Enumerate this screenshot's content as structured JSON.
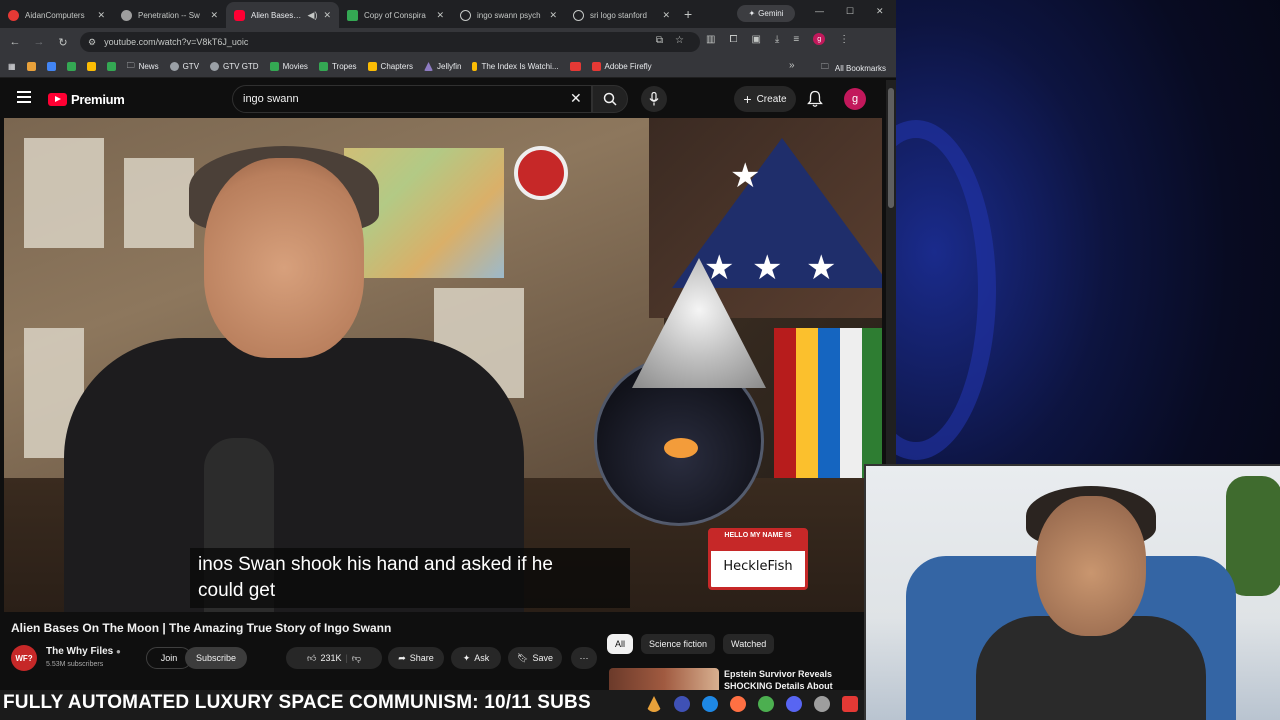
{
  "browser": {
    "tabs": [
      {
        "label": "AidanComputers",
        "color": "#e53935",
        "active": false
      },
      {
        "label": "Penetration -- Sw",
        "color": "#9e9e9e",
        "active": false
      },
      {
        "label": "Alien Bases O",
        "color": "#ff0033",
        "active": true
      },
      {
        "label": "Copy of Conspira",
        "color": "#34a853",
        "active": false
      },
      {
        "label": "ingo swann psych",
        "color": "#9e9e9e",
        "active": false
      },
      {
        "label": "sri logo stanford",
        "color": "#9e9e9e",
        "active": false
      }
    ],
    "gemini_label": "Gemini",
    "url": "youtube.com/watch?v=V8kT6J_uoic",
    "bookmarks": [
      {
        "label": "",
        "color": "#e8a13a"
      },
      {
        "label": "",
        "color": "#4285f4"
      },
      {
        "label": "",
        "color": "#34a853"
      },
      {
        "label": "",
        "color": "#fbbc04"
      },
      {
        "label": "",
        "color": "#34a853"
      },
      {
        "label": "News",
        "color": "#9aa0a6"
      },
      {
        "label": "GTV",
        "color": "#9aa0a6"
      },
      {
        "label": "GTV GTD",
        "color": "#9aa0a6"
      },
      {
        "label": "Movies",
        "color": "#34a853"
      },
      {
        "label": "Tropes",
        "color": "#34a853"
      },
      {
        "label": "Chapters",
        "color": "#fbbc04"
      },
      {
        "label": "Jellyfin",
        "color": "#8e7cc3"
      },
      {
        "label": "The Index Is Watchi...",
        "color": "#fbbc04"
      },
      {
        "label": "",
        "color": "#e53935"
      },
      {
        "label": "Adobe Firefly",
        "color": "#e53935"
      }
    ],
    "all_bookmarks_label": "All Bookmarks",
    "profile_initial": "g"
  },
  "youtube": {
    "logo_text": "Premium",
    "search_value": "ingo swann",
    "create_label": "Create",
    "avatar_initial": "g",
    "caption_lines": [
      "inos Swan shook his hand and asked if he",
      "could get"
    ],
    "name_tag_header": "HELLO MY NAME IS",
    "name_tag_name": "HeckleFish",
    "video_title": "Alien Bases On The Moon | The Amazing True Story of Ingo Swann",
    "channel_name": "The Why Files",
    "channel_avatar_text": "WF?",
    "channel_subs": "5.53M subscribers",
    "join_label": "Join",
    "subscribe_label": "Subscribe",
    "like_count": "231K",
    "share_label": "Share",
    "ask_label": "Ask",
    "save_label": "Save",
    "chips": [
      "All",
      "Science fiction",
      "Watched"
    ],
    "rec_title": "Epstein Survivor Reveals SHOCKING Details About"
  },
  "taskbar": {
    "ticker": "FULLY AUTOMATED LUXURY SPACE COMMUNISM: 10/11 SUBS",
    "tray_colors": [
      "#e8a13a",
      "#3f51b5",
      "#1e88e5",
      "#ff7043",
      "#4caf50",
      "#5865f2",
      "#9e9e9e",
      "#e53935"
    ]
  }
}
